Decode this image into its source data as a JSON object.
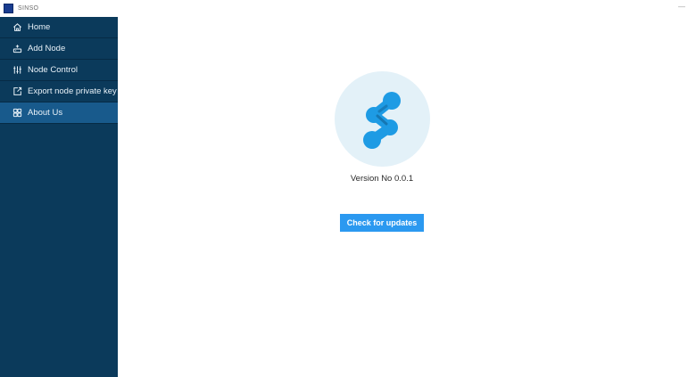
{
  "titlebar": {
    "app_title": "SINSO",
    "minimize_glyph": "—"
  },
  "sidebar": {
    "items": [
      {
        "label": "Home",
        "icon": "home-icon",
        "active": false
      },
      {
        "label": "Add Node",
        "icon": "add-node-icon",
        "active": false
      },
      {
        "label": "Node Control",
        "icon": "sliders-icon",
        "active": false
      },
      {
        "label": "Export node private key",
        "icon": "export-icon",
        "active": false
      },
      {
        "label": "About Us",
        "icon": "about-icon",
        "active": true
      }
    ]
  },
  "about": {
    "version_text": "Version No 0.0.1",
    "update_button_label": "Check for updates"
  },
  "colors": {
    "sidebar_bg": "#0b3a5b",
    "sidebar_active": "#185a8c",
    "accent_button": "#2b99f0",
    "logo_circle": "#e3f1f8",
    "logo_mark": "#1e9be4"
  }
}
